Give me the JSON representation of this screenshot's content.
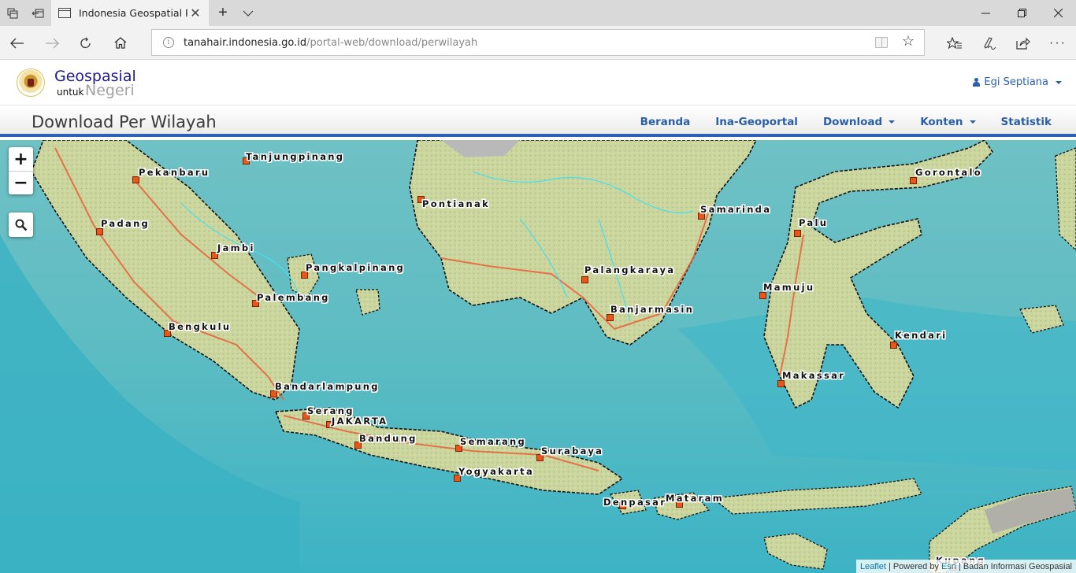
{
  "browser": {
    "tab_title": "Indonesia Geospatial Portal",
    "tab_title_visible": "Indonesia Geospatial Pc",
    "url_host": "tanahair.indonesia.go.id",
    "url_path": "/portal-web/download/perwilayah",
    "icons": {
      "tab_manager": "tabs-aside-icon",
      "set_aside": "set-tabs-aside-icon",
      "new_tab": "plus-icon",
      "tab_list": "chevron-down-icon",
      "back": "back-arrow-icon",
      "forward": "forward-arrow-icon",
      "refresh": "refresh-icon",
      "home": "home-icon",
      "reading_view": "reading-view-icon",
      "favorite": "star-icon",
      "favorites_hub": "favorites-list-icon",
      "web_note": "pen-icon",
      "share": "share-icon",
      "more": "more-icon"
    }
  },
  "site": {
    "brand_title": "Geospasial",
    "brand_sub_small": "untuk",
    "brand_sub_large": "Negeri",
    "user_name": "Egi Septiana",
    "page_title": "Download Per Wilayah",
    "menu": [
      {
        "label": "Beranda",
        "dropdown": false
      },
      {
        "label": "Ina-Geoportal",
        "dropdown": false
      },
      {
        "label": "Download",
        "dropdown": true
      },
      {
        "label": "Konten",
        "dropdown": true
      },
      {
        "label": "Statistik",
        "dropdown": false
      }
    ],
    "colors": {
      "brand_blue": "#1d1a8c",
      "link_blue": "#2a5ea7",
      "accent_bar": "#2a62b5",
      "ocean": "#46b7c4",
      "land": "#c9d39a",
      "city_marker": "#e8561a"
    }
  },
  "map": {
    "zoom_in": "+",
    "zoom_out": "−",
    "cities": [
      {
        "name": "Tanjungpinang"
      },
      {
        "name": "Pekanbaru"
      },
      {
        "name": "Padang"
      },
      {
        "name": "Jambi"
      },
      {
        "name": "Pangkalpinang"
      },
      {
        "name": "Palembang"
      },
      {
        "name": "Bengkulu"
      },
      {
        "name": "Bandarlampung"
      },
      {
        "name": "Serang"
      },
      {
        "name": "JAKARTA"
      },
      {
        "name": "Bandung"
      },
      {
        "name": "Semarang"
      },
      {
        "name": "Yogyakarta"
      },
      {
        "name": "Surabaya"
      },
      {
        "name": "Denpasar"
      },
      {
        "name": "Mataram"
      },
      {
        "name": "Kupang"
      },
      {
        "name": "Pontianak"
      },
      {
        "name": "Palangkaraya"
      },
      {
        "name": "Banjarmasin"
      },
      {
        "name": "Samarinda"
      },
      {
        "name": "Gorontalo"
      },
      {
        "name": "Palu"
      },
      {
        "name": "Mamuju"
      },
      {
        "name": "Makassar"
      },
      {
        "name": "Kendari"
      }
    ],
    "attribution": {
      "leaflet": "Leaflet",
      "powered_by": "Powered by",
      "esri": "Esri",
      "source": "Badan Informasi Geospasial"
    }
  }
}
